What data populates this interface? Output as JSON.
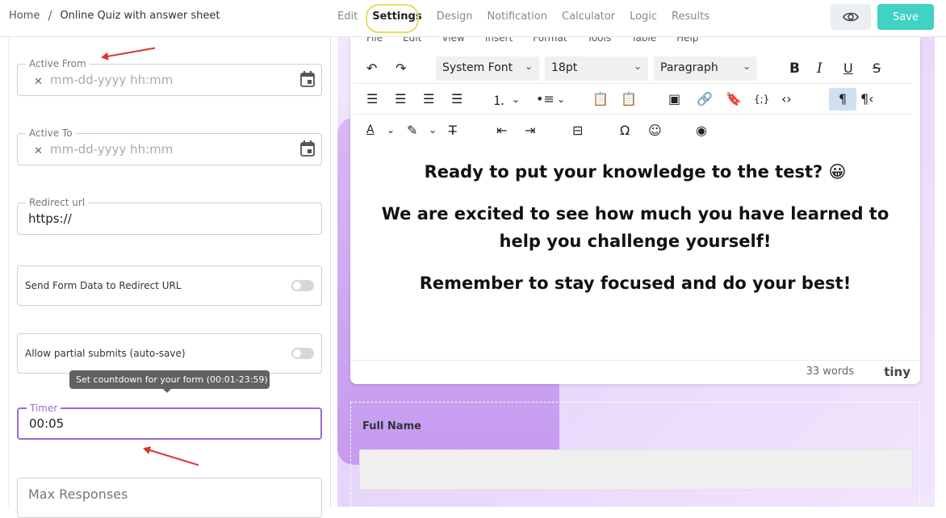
{
  "breadcrumb": {
    "home": "Home",
    "separator": "/",
    "current": "Online Quiz with answer sheet"
  },
  "tabs": [
    "Edit",
    "Settings",
    "Design",
    "Notification",
    "Calculator",
    "Logic",
    "Results"
  ],
  "active_tab": "Settings",
  "header": {
    "save_label": "Save"
  },
  "sidebar": {
    "active_from": {
      "label": "Active From",
      "placeholder": "mm-dd-yyyy hh:mm",
      "clear": "✕"
    },
    "active_to": {
      "label": "Active To",
      "placeholder": "mm-dd-yyyy hh:mm",
      "clear": "✕"
    },
    "redirect": {
      "label": "Redirect url",
      "value": "https://"
    },
    "send_form_data": {
      "label": "Send Form Data to Redirect URL",
      "on": false
    },
    "partial_submits": {
      "label": "Allow partial submits (auto-save)",
      "on": false
    },
    "tooltip": "Set countdown for your form (00:01-23:59)",
    "timer": {
      "label": "Timer",
      "value": "00:05"
    },
    "max_responses": {
      "placeholder": "Max Responses"
    }
  },
  "editor": {
    "menu": [
      "File",
      "Edit",
      "View",
      "Insert",
      "Format",
      "Tools",
      "Table",
      "Help"
    ],
    "font_family": "System Font",
    "font_size": "18pt",
    "block": "Paragraph",
    "content": [
      "Ready to put your knowledge to the test? 😀",
      "We are excited to see how much you have learned to help you challenge yourself!",
      "Remember to stay focused and do your best!"
    ],
    "word_count": "33 words",
    "brand": "tiny"
  },
  "form": {
    "field_label": "Full Name"
  },
  "colors": {
    "accent": "#40d2c2",
    "focus": "#9b6bd6",
    "annotation": "#d9362b",
    "highlight": "#e9dd5a"
  }
}
